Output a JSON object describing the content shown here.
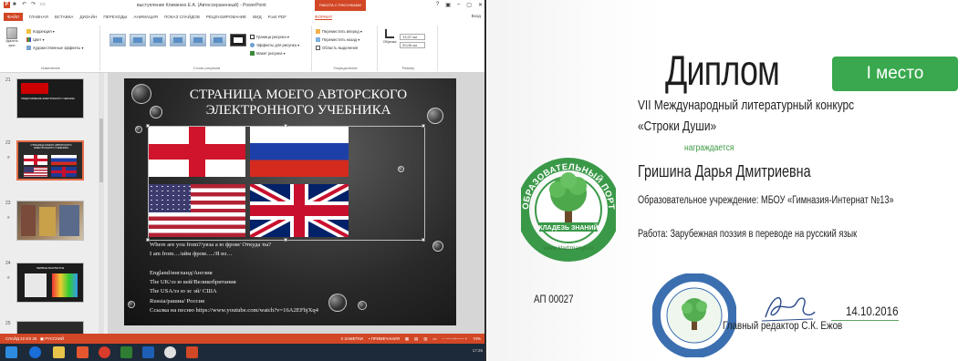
{
  "ppt": {
    "window_title": "выступление Клименко Е.А. (Автосохраненный) - PowerPoint",
    "contextual_tab_group": "РАБОТА С РИСУНКАМИ",
    "window_controls": [
      "?",
      "▣",
      "–",
      "▢",
      "✕"
    ],
    "login_label": "Вход",
    "tabs": [
      "ФАЙЛ",
      "ГЛАВНАЯ",
      "ВСТАВКА",
      "ДИЗАЙН",
      "ПЕРЕХОДЫ",
      "АНИМАЦИЯ",
      "ПОКАЗ СЛАЙДОВ",
      "РЕЦЕНЗИРОВАНИЕ",
      "ВИД",
      "Foxit PDF",
      "ФОРМАТ"
    ],
    "ribbon": {
      "adjust": {
        "remove_bg": "Удалить фон",
        "corrections": "Коррекция",
        "color": "Цвет",
        "artistic": "Художественные эффекты",
        "group_label": "Изменение"
      },
      "styles": {
        "border": "Граница рисунка",
        "effects": "Эффекты для рисунка",
        "layout": "Макет рисунка",
        "group_label": "Стили рисунков"
      },
      "arrange": {
        "bring_forward": "Переместить вперед",
        "send_backward": "Переместить назад",
        "selection_pane": "Область выделения",
        "group_label": "Упорядочение"
      },
      "size": {
        "crop": "Обрезка",
        "height": "13,97 см",
        "width": "20,06 см",
        "group_label": "Размер"
      }
    },
    "thumbnails": [
      {
        "num": "21",
        "title": "ПРЕДСТАВЛЕНИЕ ЭЛЕКТРОННОГО УЧЕБНИКА"
      },
      {
        "num": "22",
        "title": "СТРАНИЦА МОЕГО АВТОРСКОГО ЭЛЕКТРОННОГО УЧЕБНИКА"
      },
      {
        "num": "23",
        "title": ""
      },
      {
        "num": "24",
        "title": "ПЕРВЫЕ РЕЗУЛЬТАТЫ"
      },
      {
        "num": "25",
        "title": ""
      }
    ],
    "slide": {
      "title_line1": "СТРАНИЦА  МОЕГО АВТОРСКОГО",
      "title_line2": "ЭЛЕКТРОННОГО УЧЕБНИКА",
      "lines": [
        "Where are you from?/увэа а ю фром/ Откуда ты?",
        "I am from…/айм фром…./Я из…",
        "",
        "England/ингланд/Англия",
        "The UK/зэ ю кей/Великобритания",
        "The USA/зэ ю эс эй/ США",
        "Russia/рашиа/ Россия",
        "Ссылка на песню https://www.youtube.com/watch?v=16A2EFbjXq4"
      ]
    },
    "status": {
      "slide_info": "СЛАЙД 22 ИЗ 26",
      "language": "РУССКИЙ",
      "notes": "ЗАМЕТКИ",
      "comments": "ПРИМЕЧАНИЯ",
      "zoom": "74%"
    },
    "clock": "17:26"
  },
  "diploma": {
    "title": "Диплом",
    "place": "I место",
    "contest_line1": "VII Международный литературный конкурс",
    "contest_line2": "«Строки Души»",
    "awarded": "награждается",
    "recipient": "Гришина Дарья Дмитриевна",
    "school": "Образовательное учреждение: МБОУ «Гимназия-Интернат №13»",
    "work": "Работа: Зарубежная поэзия в переводе на русский язык",
    "number": "АП 00027",
    "date": "14.10.2016",
    "editor": "Главный редактор С.К. Ежов",
    "seal_text": "ОБРАЗОВАТЕЛЬНЫЙ ПОРТАЛ",
    "seal_subtext": "КЛАДЕЗЬ ЗНАНИЙ",
    "seal_url": "www.kladznanyi.ru",
    "accent_green": "#39a84e"
  }
}
